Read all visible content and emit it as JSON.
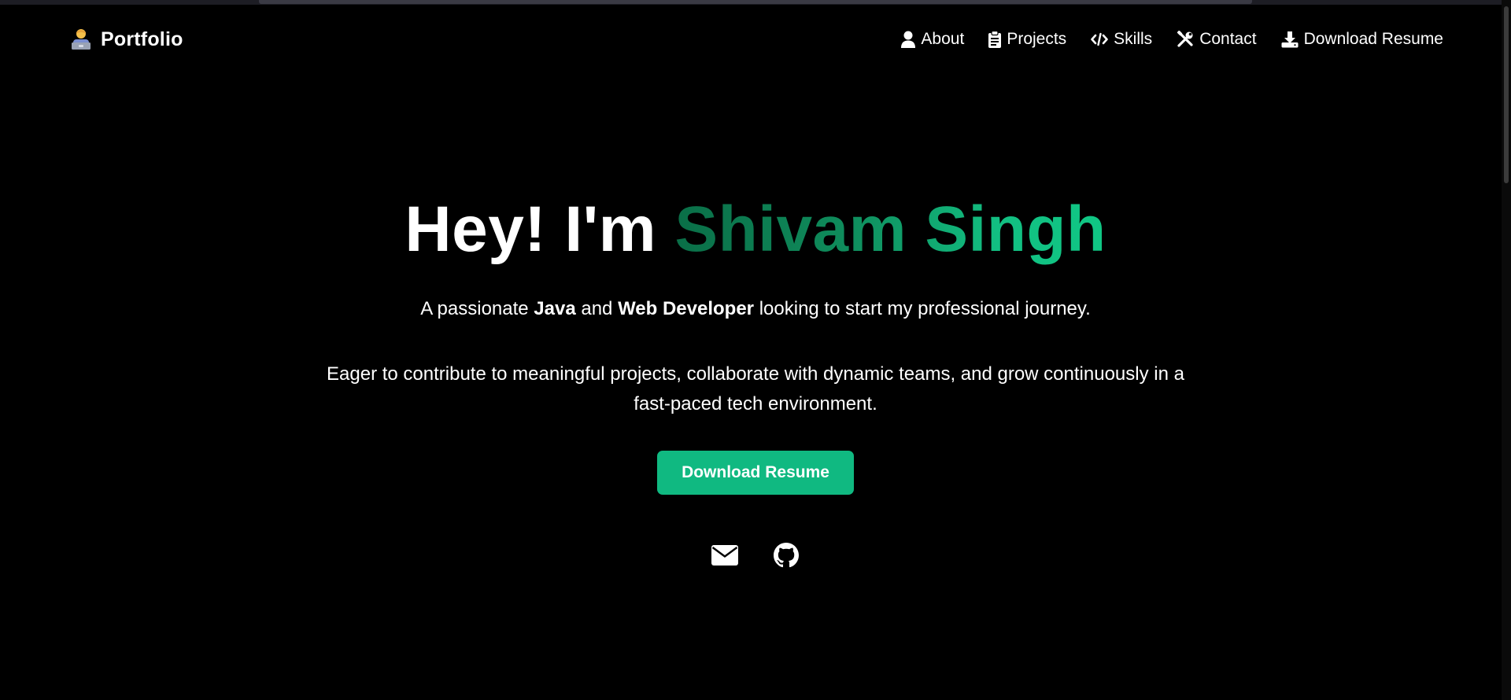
{
  "brand": {
    "title": "Portfolio",
    "icon": "technologist-emoji"
  },
  "nav": {
    "items": [
      {
        "label": "About",
        "icon": "user-icon"
      },
      {
        "label": "Projects",
        "icon": "clipboard-icon"
      },
      {
        "label": "Skills",
        "icon": "code-icon"
      },
      {
        "label": "Contact",
        "icon": "tools-icon"
      },
      {
        "label": "Download Resume",
        "icon": "download-icon"
      }
    ]
  },
  "hero": {
    "greeting": "Hey! I'm",
    "name": "Shivam Singh",
    "sub_prefix": "A passionate",
    "sub_java": "Java",
    "sub_and": "and",
    "sub_web": "Web Developer",
    "sub_suffix": "looking to start my professional journey.",
    "description": "Eager to contribute to meaningful projects, collaborate with dynamic teams, and grow continuously in a fast-paced tech environment.",
    "cta_label": "Download Resume"
  },
  "socials": [
    {
      "icon": "envelope-icon"
    },
    {
      "icon": "github-icon"
    }
  ],
  "colors": {
    "background": "#000000",
    "accent": "#10b981",
    "name_gradient_start": "#0a6e47",
    "name_gradient_end": "#10c784",
    "text": "#ffffff"
  }
}
